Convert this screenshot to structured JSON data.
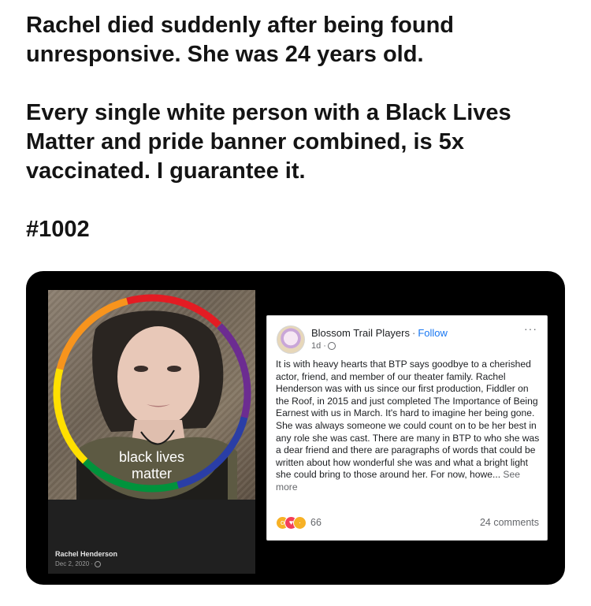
{
  "post": {
    "line1": "Rachel died suddenly after being found unresponsive. She was 24 years old.",
    "line2": "Every single white person with a Black Lives Matter and pride banner combined, is 5x vaccinated. I guarantee it.",
    "tag": "#1002"
  },
  "profile_photo": {
    "frame_label_1": "black lives",
    "frame_label_2": "matter",
    "author_name": "Rachel Henderson",
    "author_date": "Dec 2, 2020 ·"
  },
  "fb_post": {
    "page_name": "Blossom Trail Players",
    "separator": "·",
    "follow_label": "Follow",
    "time": "1d ·",
    "more_label": "···",
    "body": "It is with heavy hearts that BTP says goodbye to a cherished actor, friend, and member of our theater family. Rachel Henderson was with us since our first production, Fiddler on the Roof, in 2015 and just completed The Importance of Being Earnest with us in March. It's hard to imagine her being gone. She was always someone we could count on to be her best in  any role she was cast. There are many in BTP to who she was a dear friend and there are paragraphs of words that could be written about how wonderful she was and what a bright light she could bring to those around her.  For now, howe...",
    "see_more": " See more",
    "reaction_count": "66",
    "comments": "24 comments"
  },
  "icons": {
    "wow": "wow-reaction-icon",
    "love": "love-reaction-icon",
    "sad": "sad-reaction-icon",
    "globe": "globe-icon"
  },
  "colors": {
    "link_blue": "#1877f2",
    "card_bg": "#000000"
  }
}
